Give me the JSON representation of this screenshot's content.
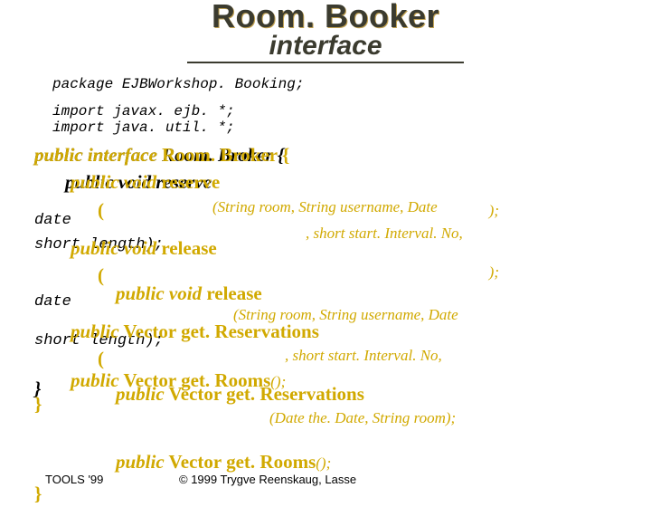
{
  "title": {
    "line1": "Room. Booker",
    "line2": "interface"
  },
  "code": {
    "package": "package EJBWorkshop. Booking;",
    "import1": "import javax. ejb. *;",
    "import2": "import java. util. *;"
  },
  "yellow": {
    "l1a": "public interface",
    "l1b": " Room. Broker {",
    "l2a": "public void",
    "l2b": " reserve",
    "l2p": "(String room, String username, Date",
    "l3": "(",
    "l3r": ");",
    "l4": ", short start. Interval. No,",
    "l5a": "public void",
    "l5b": " release",
    "l6": "(",
    "l6r": ");",
    "l7a": "public void",
    "l7b": " release",
    "l7p": "(String room, String username, Date",
    "l8a": "public",
    "l8b": " Vector get. Reservations",
    "l9": "(",
    "l9m": ", short start. Interval. No,",
    "l9r": ");",
    "l10a": "public",
    "l10b": " Vector get. Rooms",
    "l10r": "();",
    "l11a": "public",
    "l11b": " Vector get. Reservations",
    "l11p": "(Date the. Date, String room);",
    "l12": "}",
    "l13a": "public",
    "l13b": " Vector get. Rooms",
    "l13r": "();",
    "l14": "}"
  },
  "black": {
    "b1": "public interface Room. Broker {",
    "b2": "public void reserve",
    "b3": "date",
    "b4": "short length);",
    "b5": "date",
    "b6": "short length);",
    "b7": "}"
  },
  "footer": {
    "left": "TOOLS '99",
    "copyright": "© 1999 Trygve Reenskaug, Lasse"
  }
}
